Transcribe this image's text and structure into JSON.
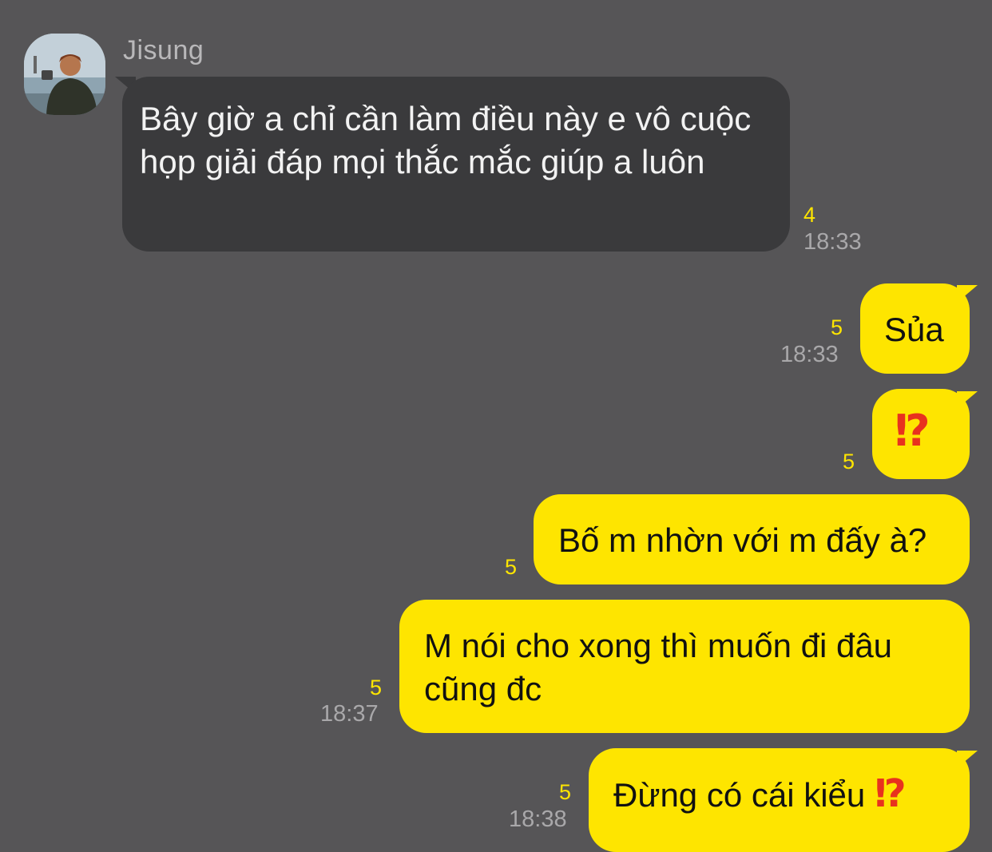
{
  "chat": {
    "sender_name": "Jisung",
    "messages": [
      {
        "text": "Bây giờ a chỉ cần làm điều này e vô cuộc họp giải đáp mọi thắc mắc giúp a luôn",
        "unread": "4",
        "time": "18:33"
      },
      {
        "text": "Sủa",
        "unread": "5",
        "time": "18:33"
      },
      {
        "text": "⁉",
        "unread": "5"
      },
      {
        "text": "Bố m nhờn với m đấy à?",
        "unread": "5"
      },
      {
        "text": "M nói cho xong thì muốn đi đâu cũng đc",
        "unread": "5",
        "time": "18:37"
      },
      {
        "text": "Đừng có cái kiểu",
        "emoji": "⁉",
        "unread": "5",
        "time": "18:38"
      }
    ]
  },
  "colors": {
    "background": "#565557",
    "incoming_bubble": "#3a3a3c",
    "outgoing_bubble": "#fee500",
    "unread_count": "#fee500",
    "emoji_red": "#e8321e"
  },
  "icons": {
    "avatar": "profile-photo-person-with-camera"
  }
}
